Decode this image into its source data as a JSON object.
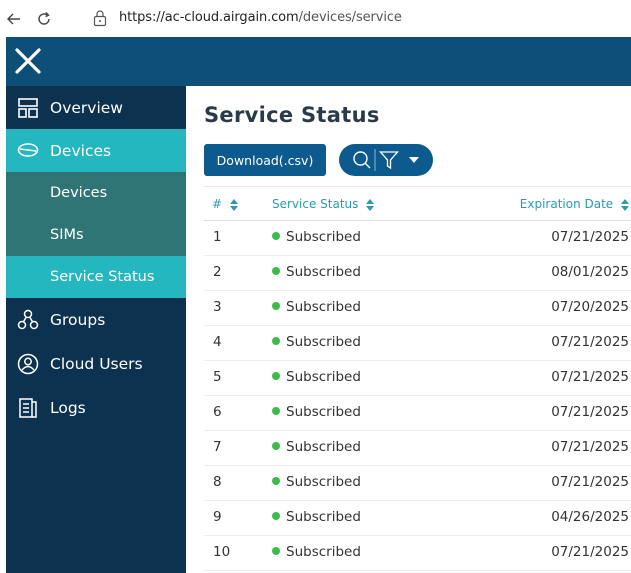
{
  "browser": {
    "url_host": "https://ac-cloud.airgain.com",
    "url_path": "/devices/service"
  },
  "sidebar": {
    "items": [
      {
        "label": "Overview",
        "icon": "layout-icon"
      },
      {
        "label": "Devices",
        "icon": "chat-bubble-icon"
      },
      {
        "label": "Groups",
        "icon": "people-group-icon"
      },
      {
        "label": "Cloud Users",
        "icon": "user-circle-icon"
      },
      {
        "label": "Logs",
        "icon": "document-icon"
      }
    ],
    "sub_items": [
      {
        "label": "Devices"
      },
      {
        "label": "SIMs"
      },
      {
        "label": "Service Status"
      }
    ]
  },
  "main": {
    "title": "Service Status",
    "download_label": "Download(.csv)",
    "columns": [
      "#",
      "Service Status",
      "Expiration Date"
    ],
    "rows": [
      {
        "num": "1",
        "status": "Subscribed",
        "expiration": "07/21/2025"
      },
      {
        "num": "2",
        "status": "Subscribed",
        "expiration": "08/01/2025"
      },
      {
        "num": "3",
        "status": "Subscribed",
        "expiration": "07/20/2025"
      },
      {
        "num": "4",
        "status": "Subscribed",
        "expiration": "07/21/2025"
      },
      {
        "num": "5",
        "status": "Subscribed",
        "expiration": "07/21/2025"
      },
      {
        "num": "6",
        "status": "Subscribed",
        "expiration": "07/21/2025"
      },
      {
        "num": "7",
        "status": "Subscribed",
        "expiration": "07/21/2025"
      },
      {
        "num": "8",
        "status": "Subscribed",
        "expiration": "07/21/2025"
      },
      {
        "num": "9",
        "status": "Subscribed",
        "expiration": "04/26/2025"
      },
      {
        "num": "10",
        "status": "Subscribed",
        "expiration": "07/21/2025"
      }
    ]
  },
  "colors": {
    "app_bar": "#0e4f78",
    "sidebar": "#0c3250",
    "active": "#25b7c0",
    "sub_bg": "#2f7575",
    "button": "#0d5a8e",
    "status_dot": "#3dbb4a",
    "header_text": "#2a9ab0"
  }
}
